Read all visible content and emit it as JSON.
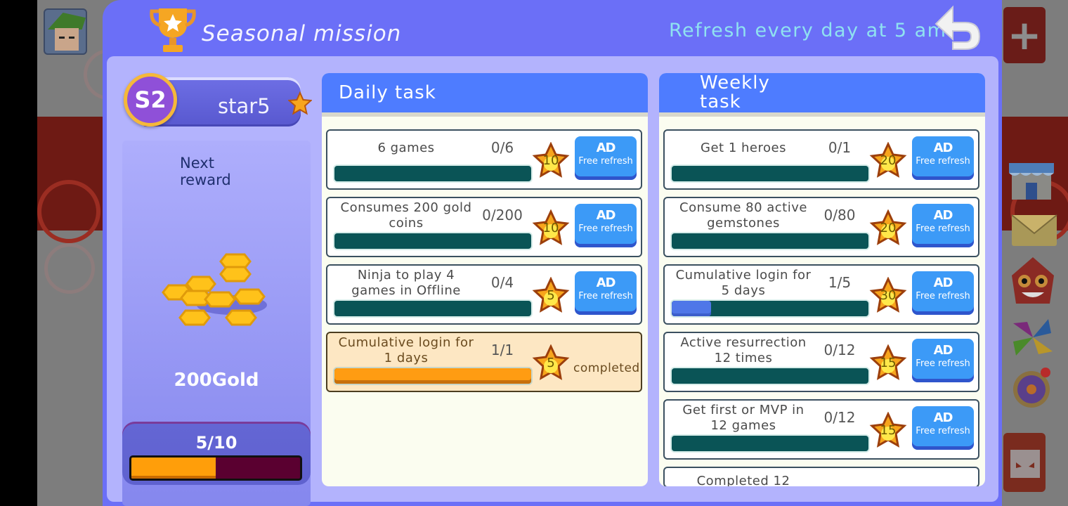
{
  "modal": {
    "title": "Seasonal mission",
    "refresh_note": "Refresh every day at 5 am",
    "back_icon": "back-arrow-icon"
  },
  "season": {
    "badge": "S2",
    "star_level": "star5",
    "next_reward_label": "Next reward",
    "reward_amount": "200Gold",
    "progress_text": "5/10",
    "progress_fraction": 0.5
  },
  "daily": {
    "header": "Daily task",
    "tasks": [
      {
        "name": "6 games",
        "count": "0/6",
        "progress": 0,
        "reward": "10",
        "action": "Free refresh",
        "ad": "AD"
      },
      {
        "name": "Consumes 200 gold coins",
        "count": "0/200",
        "progress": 0,
        "reward": "10",
        "action": "Free refresh",
        "ad": "AD"
      },
      {
        "name": "Ninja to play 4 games in Offline",
        "count": "0/4",
        "progress": 0,
        "reward": "5",
        "action": "Free refresh",
        "ad": "AD"
      },
      {
        "name": "Cumulative login for 1 days",
        "count": "1/1",
        "progress": 1,
        "reward": "5",
        "status": "completed"
      }
    ]
  },
  "weekly": {
    "header": "Weekly task",
    "tasks": [
      {
        "name": "Get 1 heroes",
        "count": "0/1",
        "progress": 0,
        "reward": "20",
        "action": "Free refresh",
        "ad": "AD"
      },
      {
        "name": "Consume 80 active gemstones",
        "count": "0/80",
        "progress": 0,
        "reward": "20",
        "action": "Free refresh",
        "ad": "AD"
      },
      {
        "name": "Cumulative login for 5 days",
        "count": "1/5",
        "progress": 0.2,
        "reward": "30",
        "action": "Free refresh",
        "ad": "AD"
      },
      {
        "name": "Active resurrection 12 times",
        "count": "0/12",
        "progress": 0,
        "reward": "15",
        "action": "Free refresh",
        "ad": "AD"
      },
      {
        "name": "Get first or MVP in 12 games",
        "count": "0/12",
        "progress": 0,
        "reward": "15",
        "action": "Free refresh",
        "ad": "AD"
      },
      {
        "name": "Completed 12",
        "partial": true
      }
    ]
  },
  "colors": {
    "modal_bg": "#6b6ff7",
    "body_bg": "#b3b3fd",
    "header_blue": "#4e7cff",
    "ad_button": "#3c9af7",
    "bar_track": "#0a5456",
    "bar_orange": "#ff9c12",
    "refresh_text": "#8fe2f0"
  }
}
